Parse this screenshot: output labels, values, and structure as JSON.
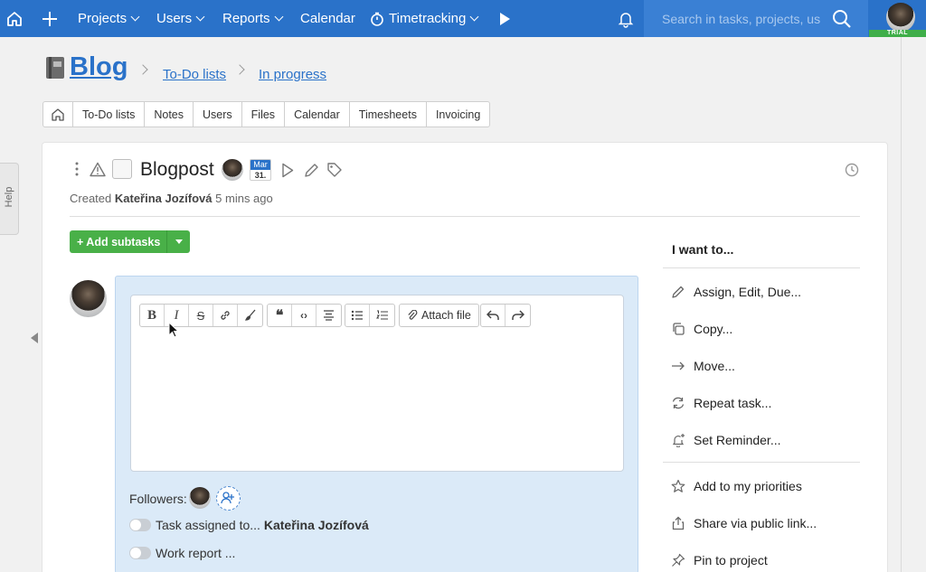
{
  "nav": {
    "projects": "Projects",
    "users": "Users",
    "reports": "Reports",
    "calendar": "Calendar",
    "timetracking": "Timetracking",
    "search_placeholder": "Search in tasks, projects, us",
    "trial_badge": "TRIAL"
  },
  "page": {
    "title": "Blog",
    "breadcrumb": [
      "To-Do lists",
      "In progress"
    ]
  },
  "tabs": [
    "To-Do lists",
    "Notes",
    "Users",
    "Files",
    "Calendar",
    "Timesheets",
    "Invoicing"
  ],
  "task": {
    "title": "Blogpost",
    "due_month": "Mar",
    "due_day": "31.",
    "created_prefix": "Created",
    "created_by": "Kateřina Jozífová",
    "created_ago": "5 mins ago"
  },
  "add_subtasks": "+ Add subtasks",
  "editor": {
    "attach_file": "Attach file"
  },
  "followers_label": "Followers:",
  "options": {
    "task_assigned_prefix": "Task assigned to...",
    "task_assigned_user": "Kateřina Jozífová",
    "work_report": "Work report ..."
  },
  "sidebar": {
    "heading": "I want to...",
    "actions": [
      "Assign, Edit, Due...",
      "Copy...",
      "Move...",
      "Repeat task...",
      "Set Reminder..."
    ],
    "actions2": [
      "Add to my priorities",
      "Share via public link...",
      "Pin to project"
    ]
  },
  "help_tab": "Help",
  "colors": {
    "nav": "#2a72c9",
    "accent": "#2a72c9",
    "green": "#49b048",
    "panel": "#dbeaf8"
  }
}
